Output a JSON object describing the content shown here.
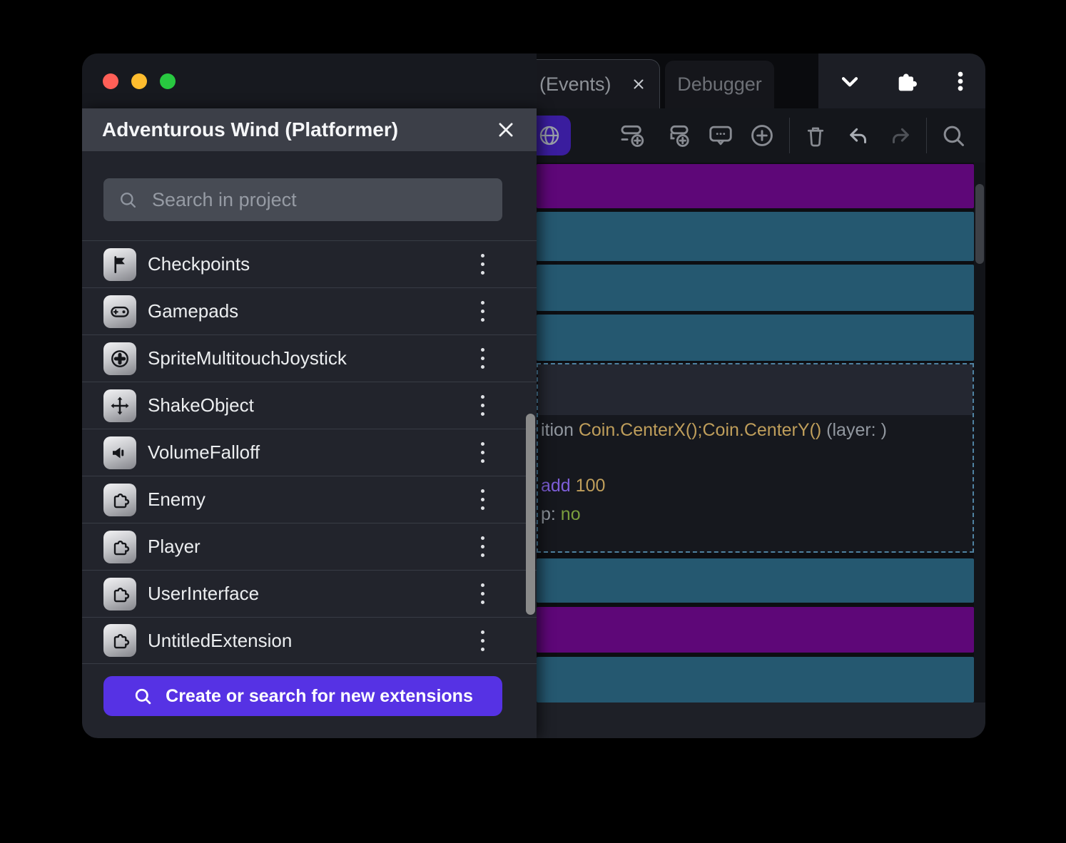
{
  "tabs": {
    "events_label": "(Events)",
    "debugger_label": "Debugger"
  },
  "modal": {
    "title": "Adventurous Wind (Platformer)",
    "search_placeholder": "Search in project",
    "items": [
      {
        "label": "Checkpoints",
        "icon": "flag-icon"
      },
      {
        "label": "Gamepads",
        "icon": "gamepad-icon"
      },
      {
        "label": "SpriteMultitouchJoystick",
        "icon": "joystick-icon"
      },
      {
        "label": "ShakeObject",
        "icon": "move-arrows-icon"
      },
      {
        "label": "VolumeFalloff",
        "icon": "speaker-icon"
      },
      {
        "label": "Enemy",
        "icon": "puzzle-icon"
      },
      {
        "label": "Player",
        "icon": "puzzle-icon"
      },
      {
        "label": "UserInterface",
        "icon": "puzzle-icon"
      },
      {
        "label": "UntitledExtension",
        "icon": "puzzle-icon"
      }
    ],
    "cta_label": "Create or search for new extensions"
  },
  "events_editor": {
    "code": {
      "line1_pre": "ition ",
      "line1_expr": "Coin.CenterX();Coin.CenterY()",
      "line1_post": " (layer: )",
      "line2_keyword": "add",
      "line2_value": "100",
      "line3_pre": "p: ",
      "line3_value": "no"
    }
  },
  "colors": {
    "cta_purple": "#5632e4",
    "event_row_purple": "#5e0778",
    "event_row_teal": "#255870",
    "selection_dash": "#4f82a1",
    "expression_gold": "#bf9e5b",
    "keyword_purple": "#7e5ed8",
    "value_green": "#7a9e3d",
    "modal_header": "#3c3f48",
    "modal_bg": "#22242c",
    "traffic_red": "#ff5f57",
    "traffic_yellow": "#febc2e",
    "traffic_green": "#28c840"
  }
}
